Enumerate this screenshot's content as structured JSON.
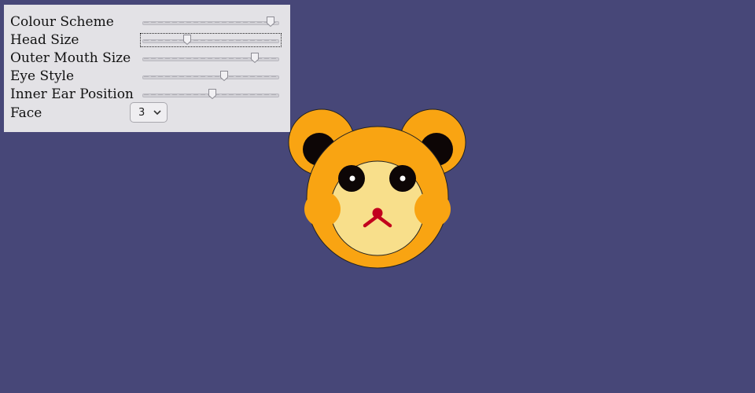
{
  "controls": {
    "sliders": [
      {
        "label": "Colour Scheme",
        "value": 0.96
      },
      {
        "label": "Head Size",
        "value": 0.32
      },
      {
        "label": "Outer Mouth Size",
        "value": 0.84
      },
      {
        "label": "Eye Style",
        "value": 0.6
      },
      {
        "label": "Inner Ear Position",
        "value": 0.51
      }
    ],
    "face": {
      "label": "Face",
      "value": "3"
    }
  },
  "colors": {
    "background": "#474778",
    "panel": "#e3e2e6",
    "head": "#f9a412",
    "mouth_area": "#f8df8b",
    "eye": "#0d0606",
    "nose": "#c2001d"
  },
  "icons": {
    "select_arrow": "chevron-down-icon",
    "bear": "bear-face"
  }
}
